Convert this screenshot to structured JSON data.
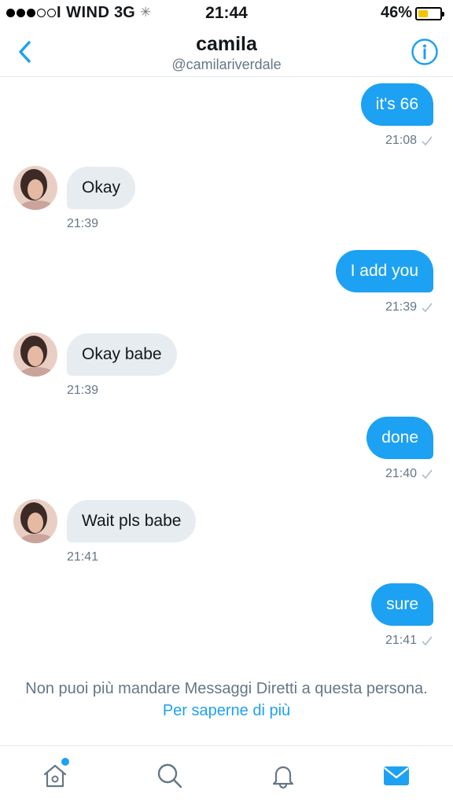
{
  "status_bar": {
    "carrier": "I WIND",
    "network": "3G",
    "spinner": "✳",
    "time": "21:44",
    "battery_percent": "46%",
    "signal_bars_filled": 3,
    "signal_bars_total": 5,
    "battery_level": 0.46
  },
  "header": {
    "title": "camila",
    "handle": "@camilariverdale"
  },
  "messages": [
    {
      "direction": "sent",
      "text": "it's  66",
      "time": "21:08"
    },
    {
      "direction": "received",
      "text": "Okay",
      "time": "21:39"
    },
    {
      "direction": "sent",
      "text": "I add you",
      "time": "21:39"
    },
    {
      "direction": "received",
      "text": "Okay babe",
      "time": "21:39"
    },
    {
      "direction": "sent",
      "text": "done",
      "time": "21:40"
    },
    {
      "direction": "received",
      "text": "Wait pls babe",
      "time": "21:41"
    },
    {
      "direction": "sent",
      "text": "sure",
      "time": "21:41"
    }
  ],
  "notice": {
    "text": "Non puoi più mandare Messaggi Diretti a questa persona.",
    "link": "Per saperne di più"
  },
  "tabs": [
    {
      "icon": "home-icon",
      "badge": true
    },
    {
      "icon": "search-icon",
      "badge": false
    },
    {
      "icon": "bell-icon",
      "badge": false
    },
    {
      "icon": "mail-icon",
      "badge": false,
      "active": true
    }
  ],
  "colors": {
    "accent": "#1da1f2",
    "received_bubble": "#e6ecf0",
    "secondary_text": "#657786",
    "battery": "#f5c400"
  }
}
